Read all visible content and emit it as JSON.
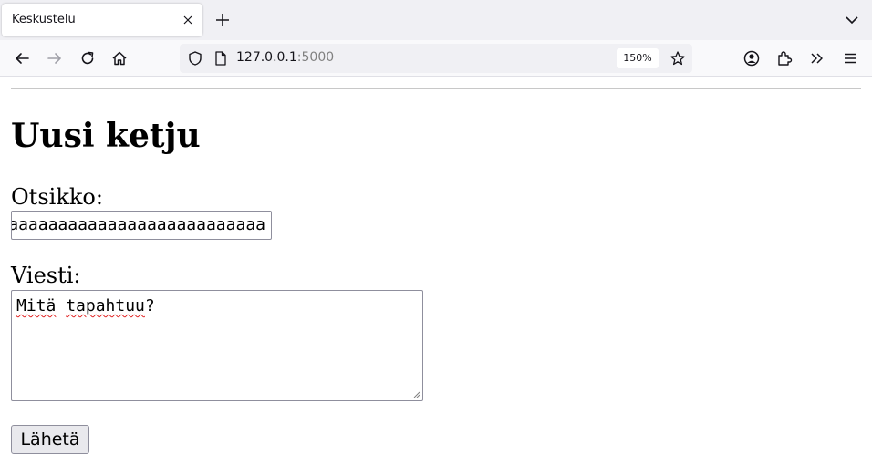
{
  "browser": {
    "tab_title": "Keskustelu",
    "url_host": "127.0.0.1",
    "url_port": ":5000",
    "zoom": "150%"
  },
  "page": {
    "title": "Uusi ketju",
    "title_label": "Otsikko:",
    "title_value": "aaaaaaaaaaaaaaaaaaaaaaaaaa",
    "message_label": "Viesti:",
    "message_words": [
      "Mitä",
      "tapahtuu",
      "?"
    ],
    "submit_label": "Lähetä"
  },
  "colors": {
    "tabbar_bg": "#f0f0f4",
    "navbar_bg": "#f9f9fb",
    "spellcheck": "#e02020",
    "button_bg": "#e9e9ed"
  },
  "icons": [
    "close-icon",
    "plus-icon",
    "chevron-down-icon",
    "back-arrow-icon",
    "forward-arrow-icon",
    "reload-icon",
    "home-icon",
    "shield-icon",
    "page-icon",
    "star-icon",
    "account-icon",
    "extensions-icon",
    "more-tools-icon",
    "menu-icon"
  ]
}
